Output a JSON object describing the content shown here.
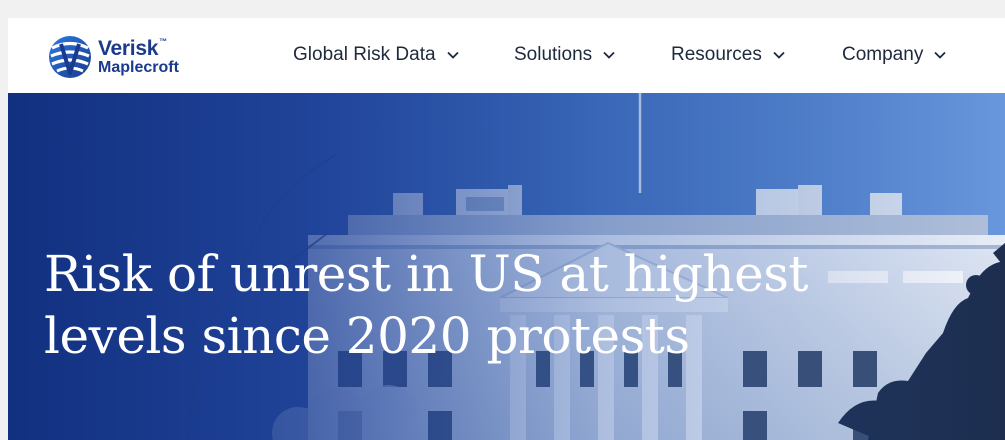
{
  "logo": {
    "brand": "Verisk",
    "trademark": "™",
    "sub": "Maplecroft"
  },
  "nav": {
    "items": [
      {
        "label": "Global Risk Data",
        "icon": "chevron-down-icon"
      },
      {
        "label": "Solutions",
        "icon": "chevron-down-icon"
      },
      {
        "label": "Resources",
        "icon": "chevron-down-icon"
      },
      {
        "label": "Company",
        "icon": "chevron-down-icon"
      }
    ]
  },
  "hero": {
    "title_line1": "Risk of unrest in US at highest",
    "title_line2": "levels since 2020 protests",
    "image": "white-house-photo"
  },
  "colors": {
    "brand_blue": "#1a3a8c",
    "logo_blue": "#2f6fd6",
    "overlay_blue": "#1c3f8f",
    "nav_text": "#1e2a3c",
    "title_text": "#ffffff"
  }
}
